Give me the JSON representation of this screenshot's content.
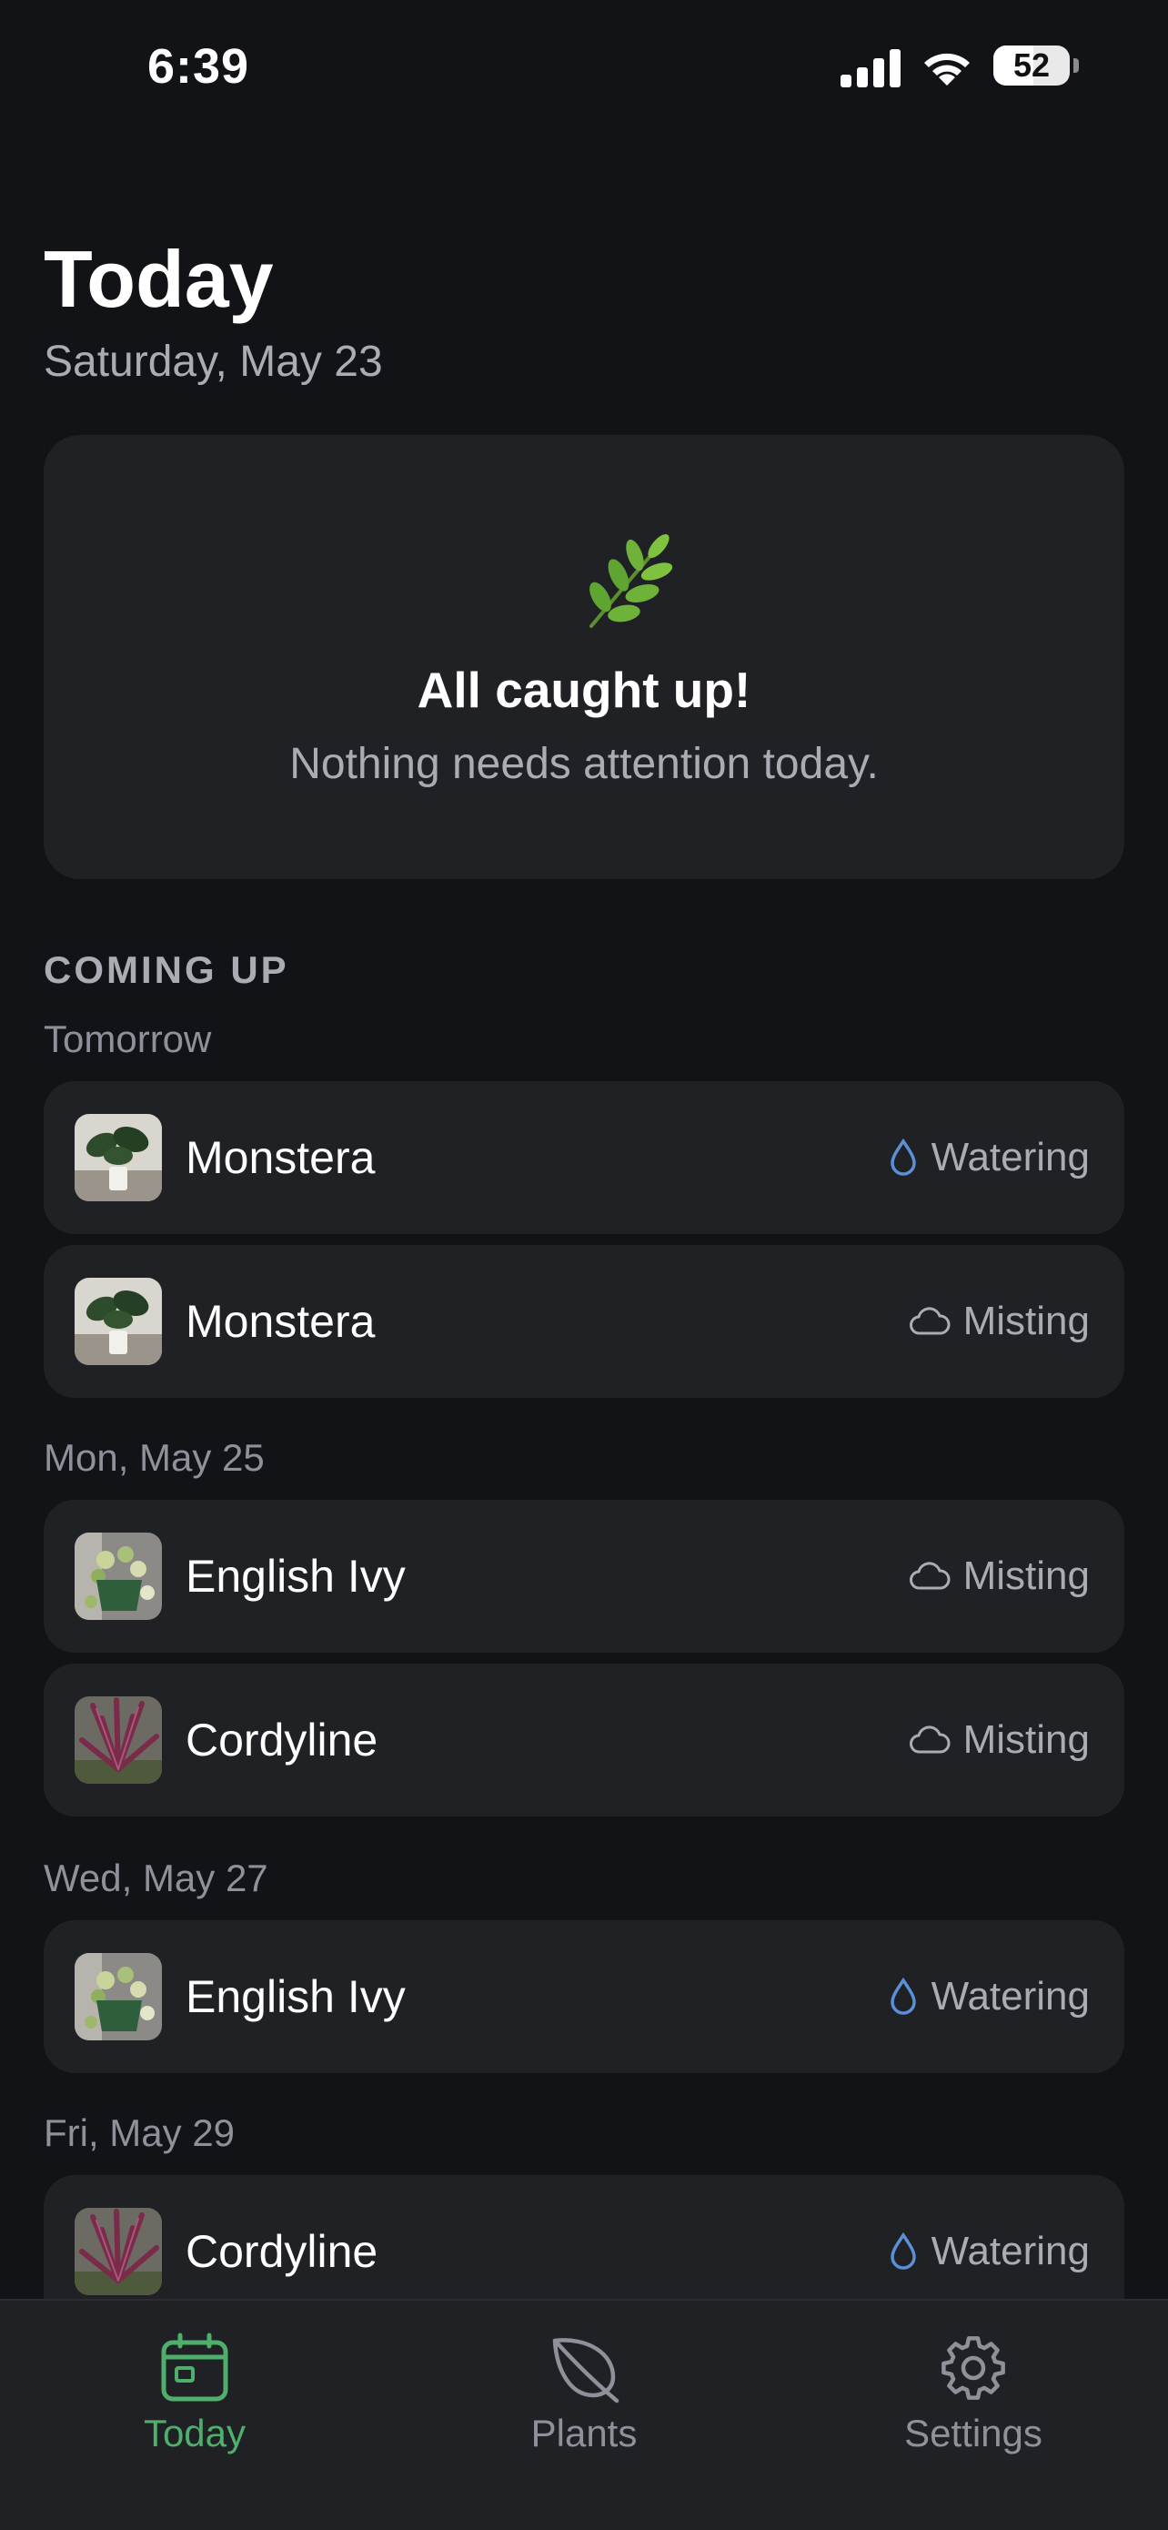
{
  "status_bar": {
    "time": "6:39",
    "battery_percent": 52,
    "battery_label": "52"
  },
  "header": {
    "title": "Today",
    "date": "Saturday, May 23"
  },
  "caught_up": {
    "icon": "sprig-icon",
    "headline": "All caught up!",
    "message": "Nothing needs attention today."
  },
  "coming_up": {
    "heading": "COMING UP",
    "groups": [
      {
        "label": "Tomorrow",
        "items": [
          {
            "plant": "Monstera",
            "task": "Watering",
            "task_icon": "water-drop-icon",
            "thumb": "monstera"
          },
          {
            "plant": "Monstera",
            "task": "Misting",
            "task_icon": "cloud-icon",
            "thumb": "monstera"
          }
        ]
      },
      {
        "label": "Mon, May 25",
        "items": [
          {
            "plant": "English Ivy",
            "task": "Misting",
            "task_icon": "cloud-icon",
            "thumb": "ivy"
          },
          {
            "plant": "Cordyline",
            "task": "Misting",
            "task_icon": "cloud-icon",
            "thumb": "cordyline"
          }
        ]
      },
      {
        "label": "Wed, May 27",
        "items": [
          {
            "plant": "English Ivy",
            "task": "Watering",
            "task_icon": "water-drop-icon",
            "thumb": "ivy"
          }
        ]
      },
      {
        "label": "Fri, May 29",
        "items": [
          {
            "plant": "Cordyline",
            "task": "Watering",
            "task_icon": "water-drop-icon",
            "thumb": "cordyline"
          }
        ]
      }
    ]
  },
  "tab_bar": {
    "tabs": [
      {
        "label": "Today",
        "icon": "calendar-icon",
        "active": true
      },
      {
        "label": "Plants",
        "icon": "leaf-icon",
        "active": false
      },
      {
        "label": "Settings",
        "icon": "gear-icon",
        "active": false
      }
    ]
  },
  "colors": {
    "accent": "#4fae6c",
    "background": "#121316",
    "card": "#1f2125",
    "water_icon": "#5b8fd6"
  }
}
